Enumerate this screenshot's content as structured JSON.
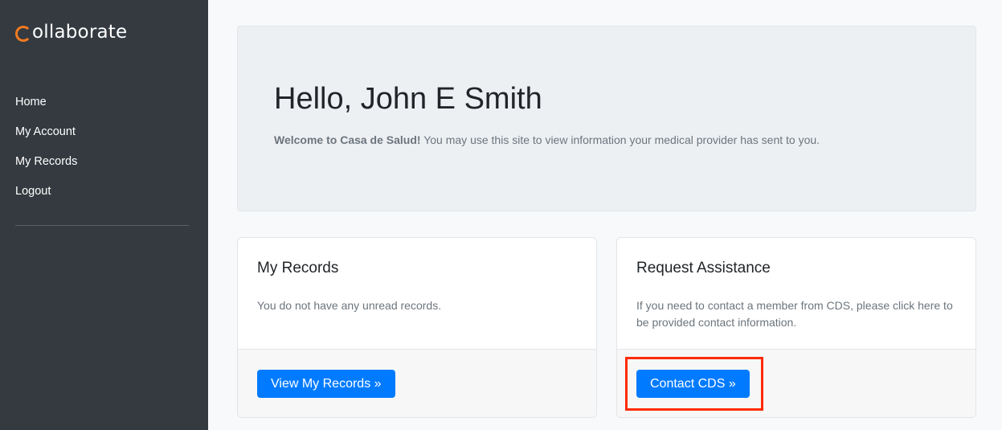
{
  "app": {
    "logo_text": "ollaborate"
  },
  "sidebar": {
    "items": [
      {
        "label": "Home"
      },
      {
        "label": "My Account"
      },
      {
        "label": "My Records"
      },
      {
        "label": "Logout"
      }
    ]
  },
  "jumbotron": {
    "greeting": "Hello, John E Smith",
    "welcome_bold": "Welcome to Casa de Salud!",
    "welcome_text": " You may use this site to view information your medical provider has sent to you."
  },
  "cards": {
    "records": {
      "title": "My Records",
      "text": "You do not have any unread records.",
      "button_label": "View My Records »"
    },
    "assistance": {
      "title": "Request Assistance",
      "text": "If you need to contact a member from CDS, please click here to be provided contact information.",
      "button_label": "Contact CDS »"
    }
  },
  "colors": {
    "sidebar_bg": "#343a40",
    "accent": "#007bff",
    "logo_orange": "#f47a20",
    "highlight_red": "#ff2a00"
  }
}
